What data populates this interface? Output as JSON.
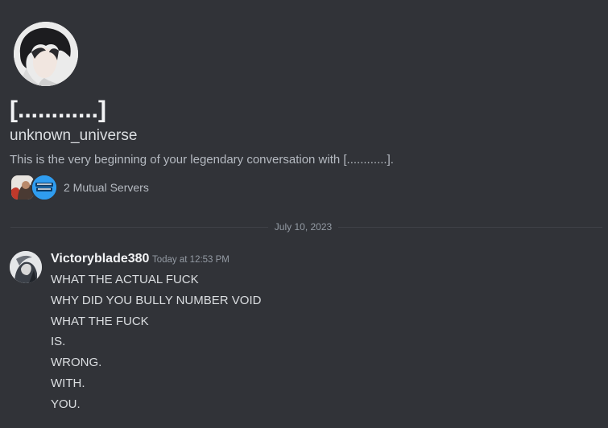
{
  "profile": {
    "display_name": "[............]",
    "username": "unknown_universe",
    "intro": "This is the very beginning of your legendary conversation with [............].",
    "mutual_servers": "2 Mutual Servers"
  },
  "separator": {
    "date": "July 10, 2023"
  },
  "message": {
    "author": "Victoryblade380",
    "timestamp": "Today at 12:53 PM",
    "lines": [
      "WHAT THE ACTUAL FUCK",
      "WHY DID YOU BULLY NUMBER VOID",
      "WHAT THE FUCK",
      "IS.",
      "WRONG.",
      "WITH.",
      "YOU."
    ]
  },
  "colors": {
    "background": "#313338",
    "text_primary": "#f2f3f5",
    "text_muted": "#949ba4",
    "server_badge_blue": "#2f9df0"
  }
}
